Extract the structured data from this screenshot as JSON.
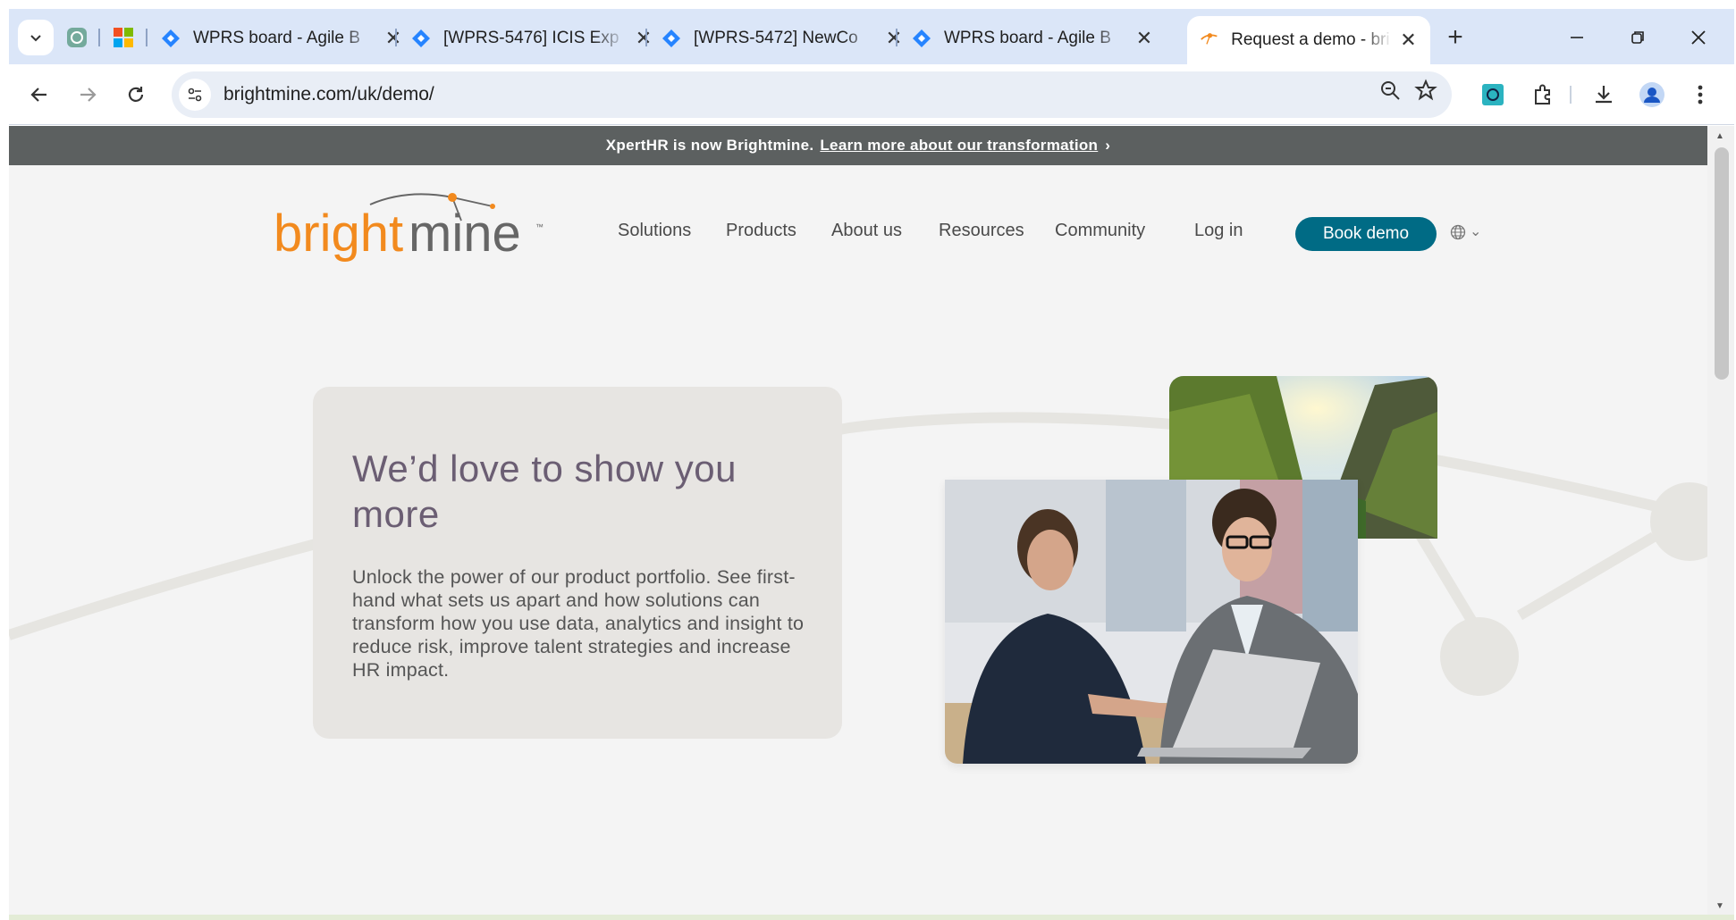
{
  "browser": {
    "tabs": [
      {
        "title": "WPRS board - Agile B",
        "close": "✕"
      },
      {
        "title": "[WPRS-5476] ICIS Exp",
        "close": "✕"
      },
      {
        "title": "[WPRS-5472] NewCo",
        "close": "✕"
      },
      {
        "title": "WPRS board - Agile B",
        "close": "✕"
      },
      {
        "title": "Request a demo - bri",
        "close": "✕",
        "active": true
      }
    ],
    "new_tab": "+",
    "window_controls": {
      "minimize": "—",
      "restore": "❐",
      "close": "✕"
    },
    "url": "brightmine.com/uk/demo/"
  },
  "page": {
    "announcement": {
      "text": "XpertHR is now Brightmine.",
      "link": "Learn more about our transformation",
      "chevron": "›"
    },
    "logo": {
      "bright": "bright",
      "mine": "mine",
      "tm": "™"
    },
    "nav": [
      "Solutions",
      "Products",
      "About us",
      "Resources",
      "Community",
      "Log in"
    ],
    "cta": "Book demo",
    "language_chevron": "⌄",
    "hero": {
      "title": "We’d love to show you more",
      "body": "Unlock the power of our product portfolio. See first-hand what sets us apart and how solutions can transform how you use data, analytics and insight to reduce risk, improve talent strategies and increase HR impact."
    }
  },
  "colors": {
    "brand_orange": "#f28a1e",
    "brand_grey": "#666666",
    "cta_teal": "#006b85",
    "title_purple": "#6b5e73",
    "tab_strip": "#dbe6f8"
  }
}
